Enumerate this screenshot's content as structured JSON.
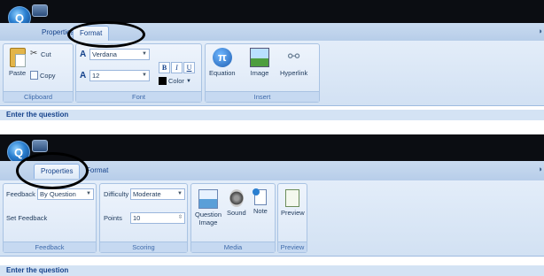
{
  "top_panel": {
    "orb_glyph": "Q",
    "tabs": {
      "properties": "Properties",
      "format": "Format"
    },
    "clipboard": {
      "paste": "Paste",
      "cut": "Cut",
      "copy": "Copy",
      "group_label": "Clipboard"
    },
    "font": {
      "font_name": "Verdana",
      "font_size": "12",
      "bold": "B",
      "italic": "I",
      "underline": "U",
      "color": "Color",
      "group_label": "Font",
      "font_icon": "A",
      "size_icon": "A"
    },
    "insert": {
      "equation": "Equation",
      "image": "Image",
      "hyperlink": "Hyperlink",
      "group_label": "Insert",
      "equation_glyph": "π"
    },
    "status": "Enter the question"
  },
  "bottom_panel": {
    "tabs": {
      "properties": "Properties",
      "format": "Format"
    },
    "feedback": {
      "label": "Feedback",
      "value": "By Question",
      "set_feedback": "Set Feedback",
      "group_label": "Feedback"
    },
    "scoring": {
      "difficulty_label": "Difficulty",
      "difficulty_value": "Moderate",
      "points_label": "Points",
      "points_value": "10",
      "group_label": "Scoring"
    },
    "media": {
      "question_image": "Question Image",
      "sound": "Sound",
      "note": "Note",
      "group_label": "Media"
    },
    "preview": {
      "label": "Preview",
      "group_label": "Preview"
    },
    "status": "Enter the question"
  },
  "colors": {
    "ribbon_bg": "#dbe7f6",
    "titlebar": "#0b0d12",
    "accent": "#15428b"
  }
}
